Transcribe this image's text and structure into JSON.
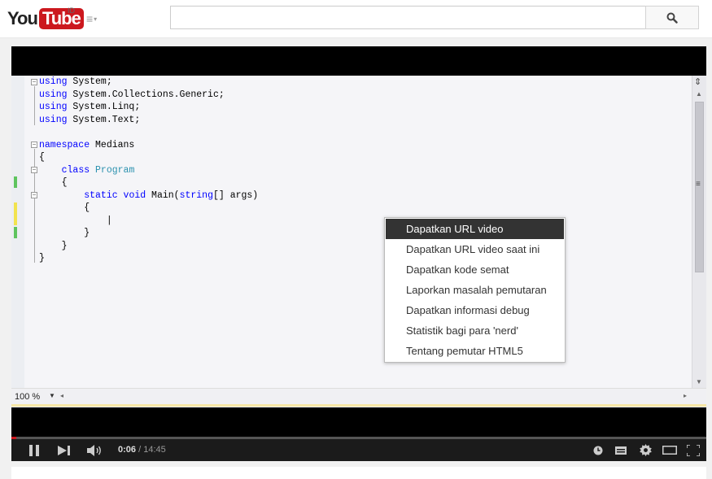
{
  "header": {
    "logo_you": "You",
    "logo_tube": "Tube",
    "country_code": "ID",
    "guide_icon": "hamburger-icon",
    "search": {
      "value": "",
      "placeholder": ""
    },
    "search_icon": "search-icon"
  },
  "editor": {
    "code_lines": [
      {
        "parts": [
          {
            "t": "using",
            "c": "kw"
          },
          {
            "t": " System;"
          }
        ]
      },
      {
        "parts": [
          {
            "t": "using",
            "c": "kw"
          },
          {
            "t": " System.Collections.Generic;"
          }
        ]
      },
      {
        "parts": [
          {
            "t": "using",
            "c": "kw"
          },
          {
            "t": " System.Linq;"
          }
        ]
      },
      {
        "parts": [
          {
            "t": "using",
            "c": "kw"
          },
          {
            "t": " System.Text;"
          }
        ]
      },
      {
        "parts": []
      },
      {
        "parts": [
          {
            "t": "namespace",
            "c": "kw"
          },
          {
            "t": " Medians"
          }
        ]
      },
      {
        "parts": [
          {
            "t": "{"
          }
        ]
      },
      {
        "parts": [
          {
            "t": "    "
          },
          {
            "t": "class",
            "c": "kw"
          },
          {
            "t": " "
          },
          {
            "t": "Program",
            "c": "ty"
          }
        ]
      },
      {
        "parts": [
          {
            "t": "    {"
          }
        ]
      },
      {
        "parts": [
          {
            "t": "        "
          },
          {
            "t": "static",
            "c": "kw"
          },
          {
            "t": " "
          },
          {
            "t": "void",
            "c": "kw"
          },
          {
            "t": " Main("
          },
          {
            "t": "string",
            "c": "kw"
          },
          {
            "t": "[] args)"
          }
        ]
      },
      {
        "parts": [
          {
            "t": "        {"
          }
        ]
      },
      {
        "parts": [
          {
            "t": "            |"
          }
        ]
      },
      {
        "parts": [
          {
            "t": "        }"
          }
        ]
      },
      {
        "parts": [
          {
            "t": "    }"
          }
        ]
      },
      {
        "parts": [
          {
            "t": "}"
          }
        ]
      }
    ],
    "zoom_label": "100 %"
  },
  "context_menu": {
    "items": [
      {
        "label": "Dapatkan URL video",
        "active": true
      },
      {
        "label": "Dapatkan URL video saat ini",
        "active": false
      },
      {
        "label": "Dapatkan kode semat",
        "active": false
      },
      {
        "label": "Laporkan masalah pemutaran",
        "active": false
      },
      {
        "label": "Dapatkan informasi debug",
        "active": false
      },
      {
        "label": "Statistik bagi para 'nerd'",
        "active": false
      },
      {
        "label": "Tentang pemutar HTML5",
        "active": false
      }
    ]
  },
  "player": {
    "current_time": "0:06",
    "separator": " / ",
    "duration": "14:45",
    "progress_fraction": 0.0068,
    "icons": [
      "pause-icon",
      "next-icon",
      "volume-icon",
      "watch-later-icon",
      "captions-icon",
      "settings-icon",
      "theater-icon",
      "fullscreen-icon"
    ]
  },
  "colors": {
    "brand_red": "#cc181e",
    "keyword_blue": "#0000ff",
    "type_teal": "#2b91af",
    "menu_active_bg": "#333333"
  }
}
